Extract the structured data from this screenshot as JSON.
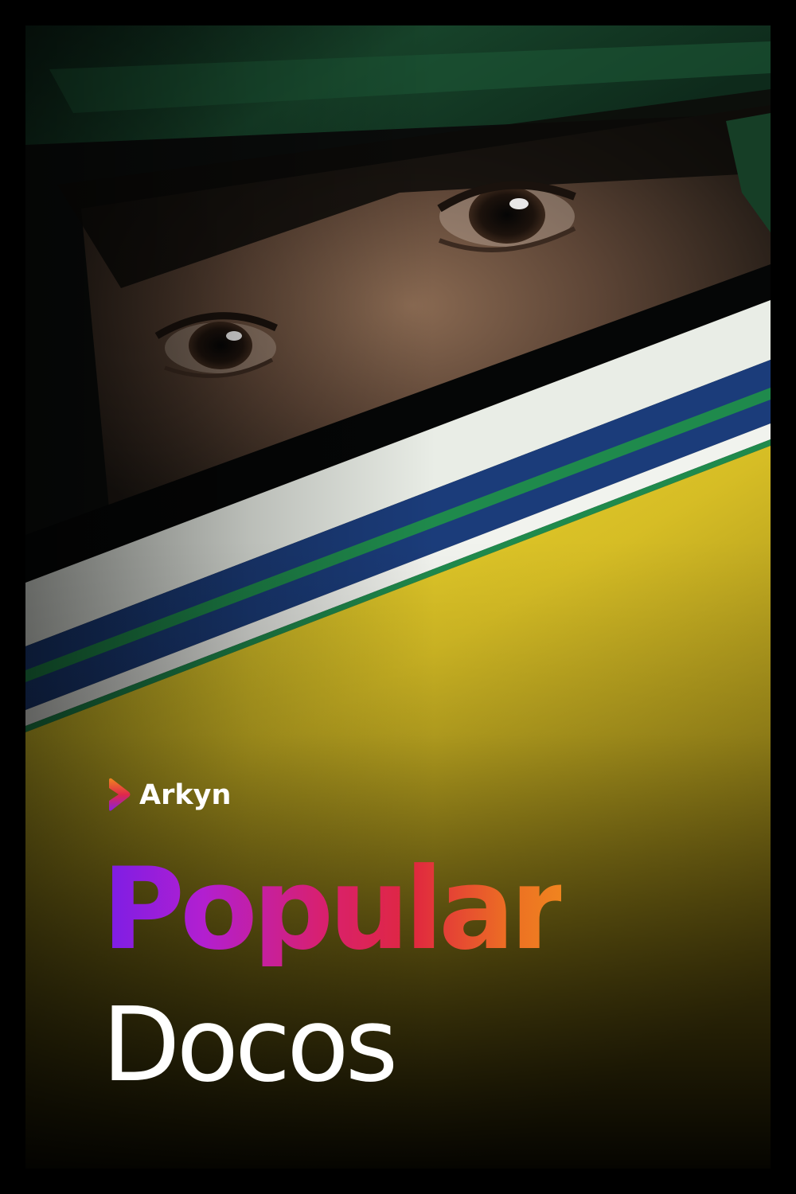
{
  "poster": {
    "brand": {
      "name": "Arkyn",
      "icon": "arkyn-logo-icon"
    },
    "title_accent": "Popular",
    "title_main": "Docos",
    "colors": {
      "frame": "#000000",
      "helmet_yellow": "#f2d92e",
      "helmet_green": "#1f4e2f",
      "visor_stripe_blue": "#1a3a78",
      "title_gradient": [
        "#7a1ee6",
        "#b21fd0",
        "#d8206f",
        "#e0283f",
        "#f0841f"
      ],
      "title_main": "#ffffff"
    }
  }
}
